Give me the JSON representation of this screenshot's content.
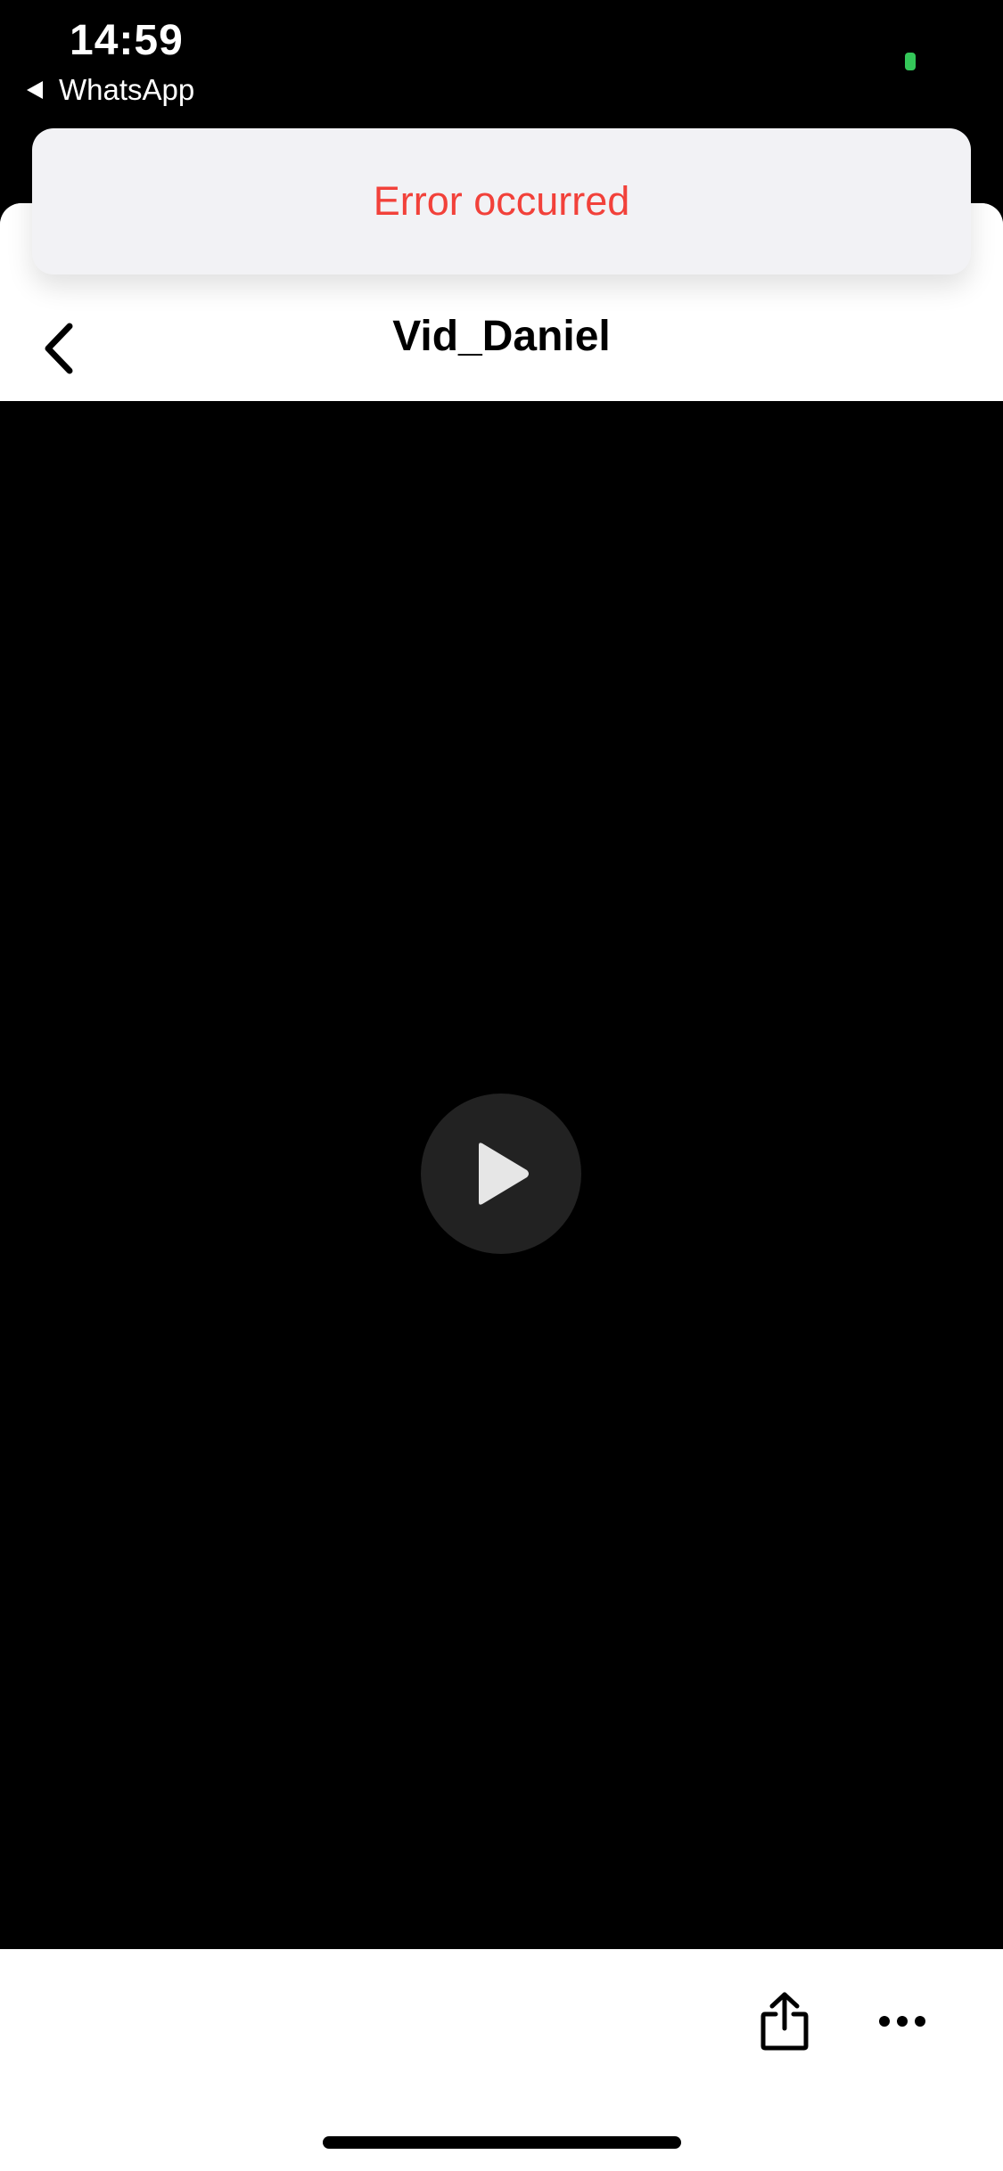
{
  "status_bar": {
    "time": "14:59",
    "back_app_label": "WhatsApp",
    "indicator_color": "#34c759"
  },
  "toast": {
    "message": "Error occurred",
    "color": "#f2413a"
  },
  "nav": {
    "title": "Vid_Daniel",
    "back_icon": "chevron-left-icon"
  },
  "player": {
    "play_icon": "play-icon"
  },
  "toolbar": {
    "share_icon": "share-icon",
    "more_icon": "more-horizontal-icon"
  }
}
